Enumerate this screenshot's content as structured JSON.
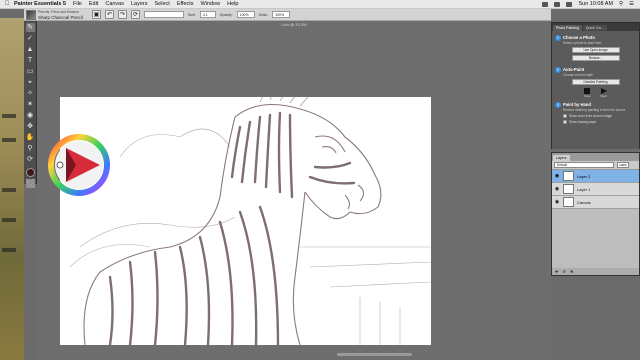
{
  "menubar": {
    "app_name": "Painter Essentials 5",
    "items": [
      "File",
      "Edit",
      "Canvas",
      "Layers",
      "Select",
      "Effects",
      "Window",
      "Help"
    ],
    "clock": "Sun 10:08 AM"
  },
  "propbar": {
    "brush_category": "Pencils, Pens and Erasers",
    "brush_variant": "Sharp Charcoal Pencil",
    "size_label": "Size:",
    "size_value": "4.1",
    "opacity_label": "Opacity:",
    "opacity_value": "100%",
    "grain_label": "Grain:",
    "grain_value": "100%"
  },
  "document": {
    "title": "Lion @ 33.3%"
  },
  "photo_panel": {
    "tabs": [
      "Photo Painting",
      "Quick Clo..."
    ],
    "step1": {
      "title": "Choose a Photo",
      "desc": "Select a photo to start from",
      "btn_open": "Use Open Image",
      "btn_browse": "Browse..."
    },
    "step2": {
      "title": "Auto-Paint",
      "desc": "Choose a brush style",
      "select": "Detailed Painting",
      "stop": "Stop",
      "start": "Start"
    },
    "step3": {
      "title": "Paint by Hand",
      "desc": "Restore detail by painting in from the source",
      "chk1": "Show color from source image",
      "chk2": "Show tracing paper"
    }
  },
  "layers_panel": {
    "tabs": [
      "Layers"
    ],
    "blend_mode": "Default",
    "opacity": "100%",
    "layers": [
      {
        "name": "Layer 2",
        "selected": true
      },
      {
        "name": "Layer 1",
        "selected": false
      },
      {
        "name": "Canvas",
        "selected": false
      }
    ]
  },
  "colors": {
    "accent_blue": "#3b8fd9",
    "selected_layer": "#7fb3e6",
    "sketch_stroke": "#8c7a7a"
  }
}
